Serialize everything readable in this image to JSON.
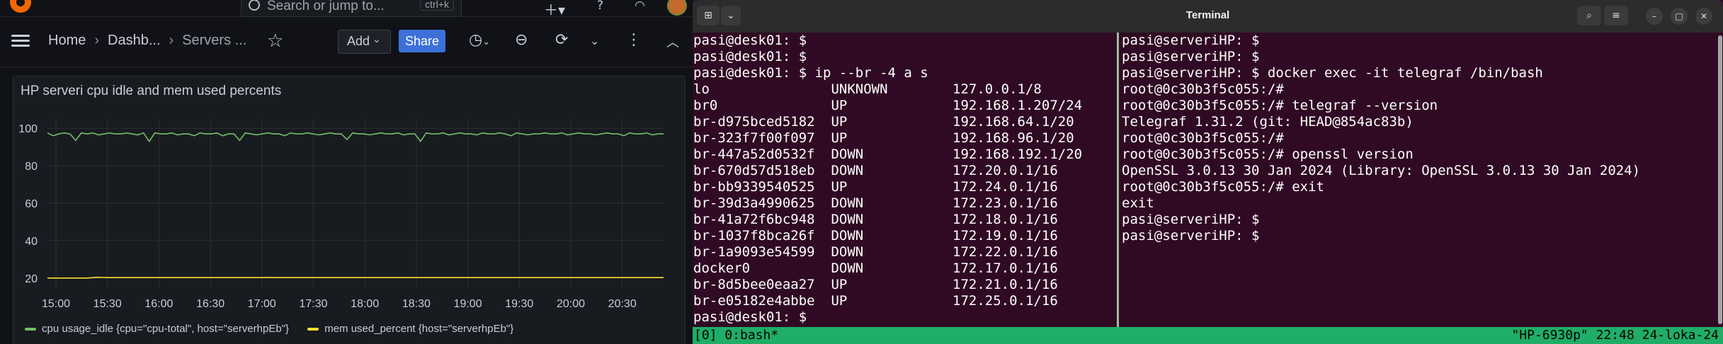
{
  "grafana": {
    "search": {
      "placeholder": "Search or jump to...",
      "shortcut": "ctrl+k"
    },
    "breadcrumbs": [
      "Home",
      "Dashb...",
      "Servers ..."
    ],
    "toolbar": {
      "add_label": "Add",
      "share_label": "Share"
    },
    "panel": {
      "title": "HP serveri cpu idle and mem used percents",
      "legend": [
        {
          "label": "cpu usage_idle {cpu=\"cpu-total\", host=\"serverhpEb\"}",
          "color": "#73bf69"
        },
        {
          "label": "mem used_percent {host=\"serverhpEb\"}",
          "color": "#fade2a"
        }
      ]
    }
  },
  "chart_data": {
    "type": "line",
    "title": "HP serveri cpu idle and mem used percents",
    "x_ticks": [
      "15:00",
      "15:30",
      "16:00",
      "16:30",
      "17:00",
      "17:30",
      "18:00",
      "18:30",
      "19:00",
      "19:30",
      "20:00",
      "20:30"
    ],
    "y_ticks": [
      20,
      40,
      60,
      80,
      100
    ],
    "ylim": [
      15,
      105
    ],
    "grid": true,
    "legend_position": "bottom-left",
    "series": [
      {
        "name": "cpu usage_idle {cpu=\"cpu-total\", host=\"serverhpEb\"}",
        "color": "#73bf69",
        "values": [
          97.5,
          96,
          97,
          97.5,
          97,
          93.5,
          97.5,
          97,
          97.5,
          96.5,
          97,
          97.5,
          97,
          97,
          97.5,
          97,
          96.5,
          97.5,
          93,
          97.5,
          97,
          97,
          97.5,
          96.5,
          97,
          97,
          96,
          97.5,
          97,
          97,
          97.5,
          96,
          97,
          97,
          93.5,
          97.5,
          97,
          96.5,
          97,
          97.5,
          97,
          97,
          96,
          97.5,
          97,
          97,
          97.5,
          97,
          96.5,
          97,
          97.5,
          97,
          97,
          94,
          97.5,
          97,
          97,
          96.5,
          97,
          97.5,
          97,
          97,
          97.5,
          96.5,
          97,
          97,
          93,
          97.5,
          97,
          97,
          97.5,
          96.5,
          97,
          97.5,
          97,
          97,
          96.5,
          97.5,
          97,
          97,
          97.5,
          97,
          96,
          97.5,
          97,
          96.5,
          97,
          97,
          97.5,
          97,
          97,
          97.5,
          96.5,
          97,
          97.5,
          97,
          97,
          96.5,
          97,
          97.5,
          97,
          97,
          96,
          97.5,
          97,
          97,
          97.5,
          96.5,
          97,
          97
        ]
      },
      {
        "name": "mem used_percent {host=\"serverhpEb\"}",
        "color": "#fade2a",
        "values": [
          20,
          20,
          20,
          20,
          20,
          20,
          20,
          20,
          20.2,
          20.4,
          20.3,
          20.2,
          20.2,
          20.2,
          20.2,
          20.2,
          20.2,
          20.2,
          20.2,
          20.2,
          20.2,
          20.2,
          20.2,
          20.2,
          20.2,
          20.2,
          20.2,
          20.2,
          20.2,
          20.2,
          20.2,
          20.2,
          20.2,
          20.2,
          20.2,
          20.2,
          20.2,
          20.2,
          20.2,
          20.3,
          20.2,
          20.2,
          20.2,
          20.2,
          20.2,
          20.2,
          20.2,
          20.2,
          20.2,
          20.2,
          20.2,
          20.2,
          20.2,
          20.2,
          20.2,
          20.2,
          20.2,
          20.2,
          20.2,
          20.2,
          20.2,
          20.2,
          20.2,
          20.2,
          20.2,
          20.2,
          20.2,
          20.2,
          20.2,
          20.2,
          20.2,
          20.2,
          20.2,
          20.2,
          20.2,
          20.2,
          20.2,
          20.2,
          20.2,
          20.2,
          20.2,
          20.2,
          20.2,
          20.2,
          20.2,
          20.2,
          20.2,
          20.2,
          20.2,
          20.2,
          20.2,
          20.2,
          20.2,
          20.2,
          20.2,
          20.2,
          20.2,
          20.2,
          20.2,
          20.2,
          20.2,
          20.2,
          20.2,
          20.2,
          20.2,
          20.2,
          20.2,
          20.2,
          20.2,
          20.2
        ]
      }
    ]
  },
  "terminal": {
    "title": "Terminal",
    "left_pane": [
      "pasi@desk01: $",
      "pasi@desk01: $",
      "pasi@desk01: $ ip --br -4 a s",
      "lo               UNKNOWN        127.0.0.1/8",
      "br0              UP             192.168.1.207/24",
      "br-d975bced5182  UP             192.168.64.1/20",
      "br-323f7f00f097  UP             192.168.96.1/20",
      "br-447a52d0532f  DOWN           192.168.192.1/20",
      "br-670d57d518eb  DOWN           172.20.0.1/16",
      "br-bb9339540525  UP             172.24.0.1/16",
      "br-39d3a4990625  DOWN           172.23.0.1/16",
      "br-41a72f6bc948  DOWN           172.18.0.1/16",
      "br-1037f8bca26f  DOWN           172.19.0.1/16",
      "br-1a9093e54599  DOWN           172.22.0.1/16",
      "docker0          DOWN           172.17.0.1/16",
      "br-8d5bee0eaa27  UP             172.21.0.1/16",
      "br-e05182e4abbe  UP             172.25.0.1/16",
      "pasi@desk01: $"
    ],
    "right_pane": [
      "pasi@serveriHP: $",
      "pasi@serveriHP: $",
      "pasi@serveriHP: $ docker exec -it telegraf /bin/bash",
      "root@0c30b3f5c055:/#",
      "root@0c30b3f5c055:/# telegraf --version",
      "Telegraf 1.31.2 (git: HEAD@854ac83b)",
      "root@0c30b3f5c055:/#",
      "root@0c30b3f5c055:/# openssl version",
      "OpenSSL 3.0.13 30 Jan 2024 (Library: OpenSSL 3.0.13 30 Jan 2024)",
      "root@0c30b3f5c055:/# exit",
      "exit",
      "pasi@serveriHP: $",
      "pasi@serveriHP: $"
    ],
    "status_left": "[0] 0:bash*",
    "status_right": "\"HP-6930p\" 22:48 24-loka-24"
  }
}
